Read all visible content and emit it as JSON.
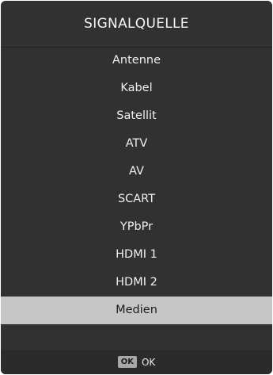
{
  "header": {
    "title": "SIGNALQUELLE"
  },
  "sources": [
    {
      "label": "Antenne",
      "selected": false
    },
    {
      "label": "Kabel",
      "selected": false
    },
    {
      "label": "Satellit",
      "selected": false
    },
    {
      "label": "ATV",
      "selected": false
    },
    {
      "label": "AV",
      "selected": false
    },
    {
      "label": "SCART",
      "selected": false
    },
    {
      "label": "YPbPr",
      "selected": false
    },
    {
      "label": "HDMI 1",
      "selected": false
    },
    {
      "label": "HDMI 2",
      "selected": false
    },
    {
      "label": "Medien",
      "selected": true
    }
  ],
  "footer": {
    "key_badge": "OK",
    "action_label": "OK"
  },
  "colors": {
    "panel_bg": "#313131",
    "selected_bg": "#c6c6c6",
    "footer_bg": "#2b2b2b"
  }
}
